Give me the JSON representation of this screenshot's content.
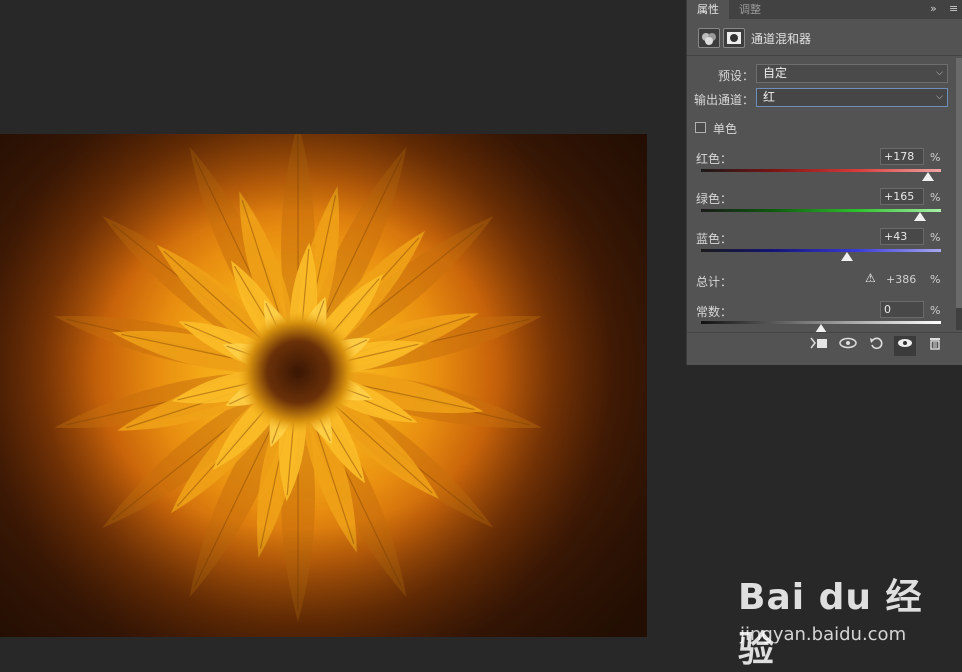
{
  "tabs": {
    "properties": "属性",
    "adjustments": "调整"
  },
  "tab_controls": {
    "collapse": "»",
    "menu": "≡"
  },
  "panel": {
    "title": "通道混和器"
  },
  "preset": {
    "label": "预设：",
    "value": "自定"
  },
  "output_channel": {
    "label": "输出通道：",
    "value": "红"
  },
  "monochrome": {
    "label": "单色",
    "checked": false
  },
  "red": {
    "label": "红色：",
    "value": "+178",
    "unit": "%",
    "level": 178,
    "color": "#e05050"
  },
  "green": {
    "label": "绿色：",
    "value": "+165",
    "unit": "%",
    "level": 165,
    "color": "#40c040"
  },
  "blue": {
    "label": "蓝色：",
    "value": "+43",
    "unit": "%",
    "level": 43,
    "color": "#5050e0"
  },
  "total": {
    "label": "总计：",
    "value": "+386",
    "unit": "%",
    "warning_icon": "warning-icon"
  },
  "constant": {
    "label": "常数：",
    "value": "0",
    "unit": "%",
    "level": 0
  },
  "footer_icons": [
    "clip-to-layer-icon",
    "view-previous-icon",
    "reset-icon",
    "visibility-icon",
    "delete-icon"
  ],
  "watermark": {
    "logo": "Bai du 经验",
    "url": "jingyan.baidu.com"
  }
}
